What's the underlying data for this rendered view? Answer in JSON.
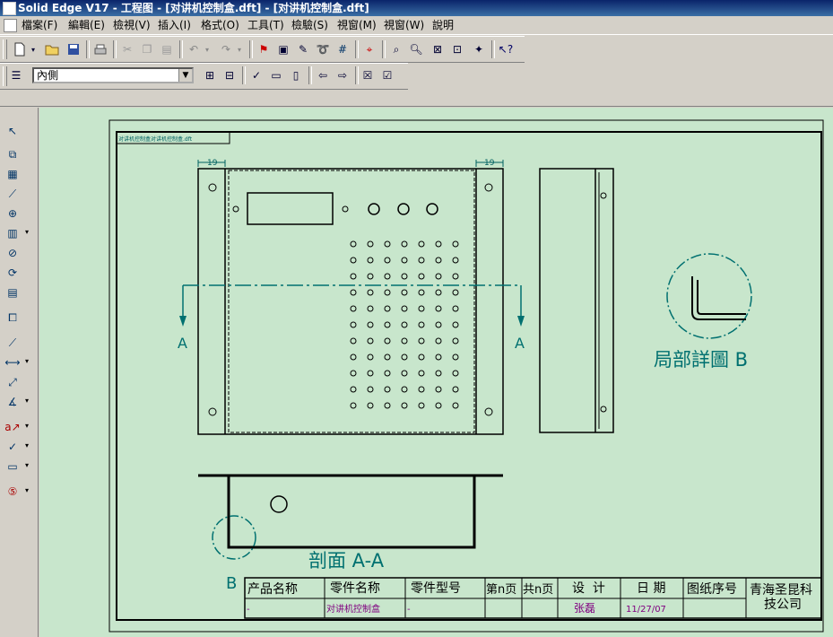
{
  "window": {
    "title": "Solid Edge V17 - 工程图 - [对讲机控制盒.dft] - [对讲机控制盒.dft]"
  },
  "menu": {
    "items": [
      "檔案(F)",
      "編輯(E)",
      "檢視(V)",
      "插入(I)",
      "格式(O)",
      "工具(T)",
      "檢驗(S)",
      "視窗(M)",
      "視窗(W)",
      "說明"
    ]
  },
  "layer_toolbar": {
    "layer_value": "內側"
  },
  "drawing": {
    "header_label": "对讲机控制盒对讲机控制盒.dft",
    "dim_left": "19",
    "dim_right": "19",
    "section_label_left": "A",
    "section_label_right": "A",
    "detail_label": "局部詳圖 B",
    "section_view_label": "剖面 A-A",
    "detail_marker": "B"
  },
  "title_block": {
    "headers": [
      "产品名称",
      "零件名称",
      "零件型号",
      "第n页",
      "共n页",
      "设  计",
      "日 期",
      "图纸序号"
    ],
    "values": [
      "-",
      "对讲机控制盒",
      "-",
      "",
      "",
      "张磊",
      "11/27/07",
      ""
    ],
    "company_line1": "青海圣昆科",
    "company_line2": "技公司"
  }
}
